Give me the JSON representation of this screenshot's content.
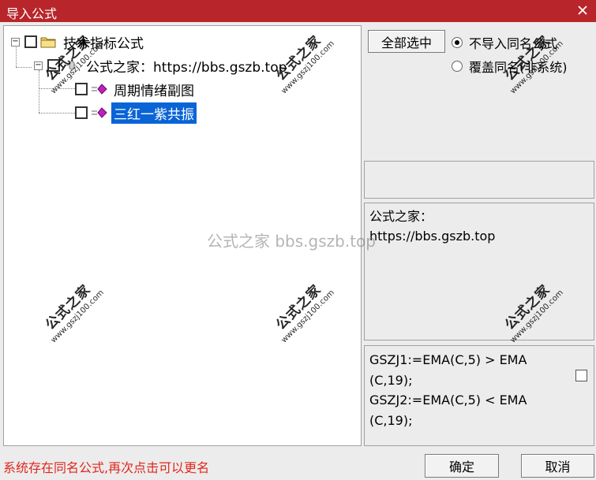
{
  "window": {
    "title": "导入公式"
  },
  "tree": {
    "root": {
      "label": "技术指标公式"
    },
    "group": {
      "label": "公式之家：https://bbs.gszb.top"
    },
    "items": [
      {
        "label": "周期情绪副图",
        "selected": false
      },
      {
        "label": "三红一紫共振",
        "selected": true
      }
    ]
  },
  "options": {
    "select_all_label": "全部选中",
    "radio_no_import": "不导入同名公式",
    "radio_no_import_selected": true,
    "radio_overwrite": "覆盖同名(非系统)",
    "radio_overwrite_selected": false
  },
  "info": {
    "line1": "公式之家：",
    "line2": "https://bbs.gszb.top"
  },
  "code": {
    "lines": [
      "GSZJ1:=EMA(C,5) > EMA",
      "(C,19);",
      "GSZJ2:=EMA(C,5) < EMA",
      "(C,19);"
    ]
  },
  "status": {
    "message": "系统存在同名公式,再次点击可以更名"
  },
  "buttons": {
    "ok_label": "确定",
    "cancel_label": "取消"
  },
  "watermark": {
    "text": "公式之家 bbs.gszb.top",
    "stamp_big": "公式之家",
    "stamp_small": "www.gszj100.com"
  },
  "colors": {
    "titlebar": "#b8262b",
    "selection": "#0a64d6",
    "status_text": "#e1261d",
    "gem": "#c020c0"
  }
}
